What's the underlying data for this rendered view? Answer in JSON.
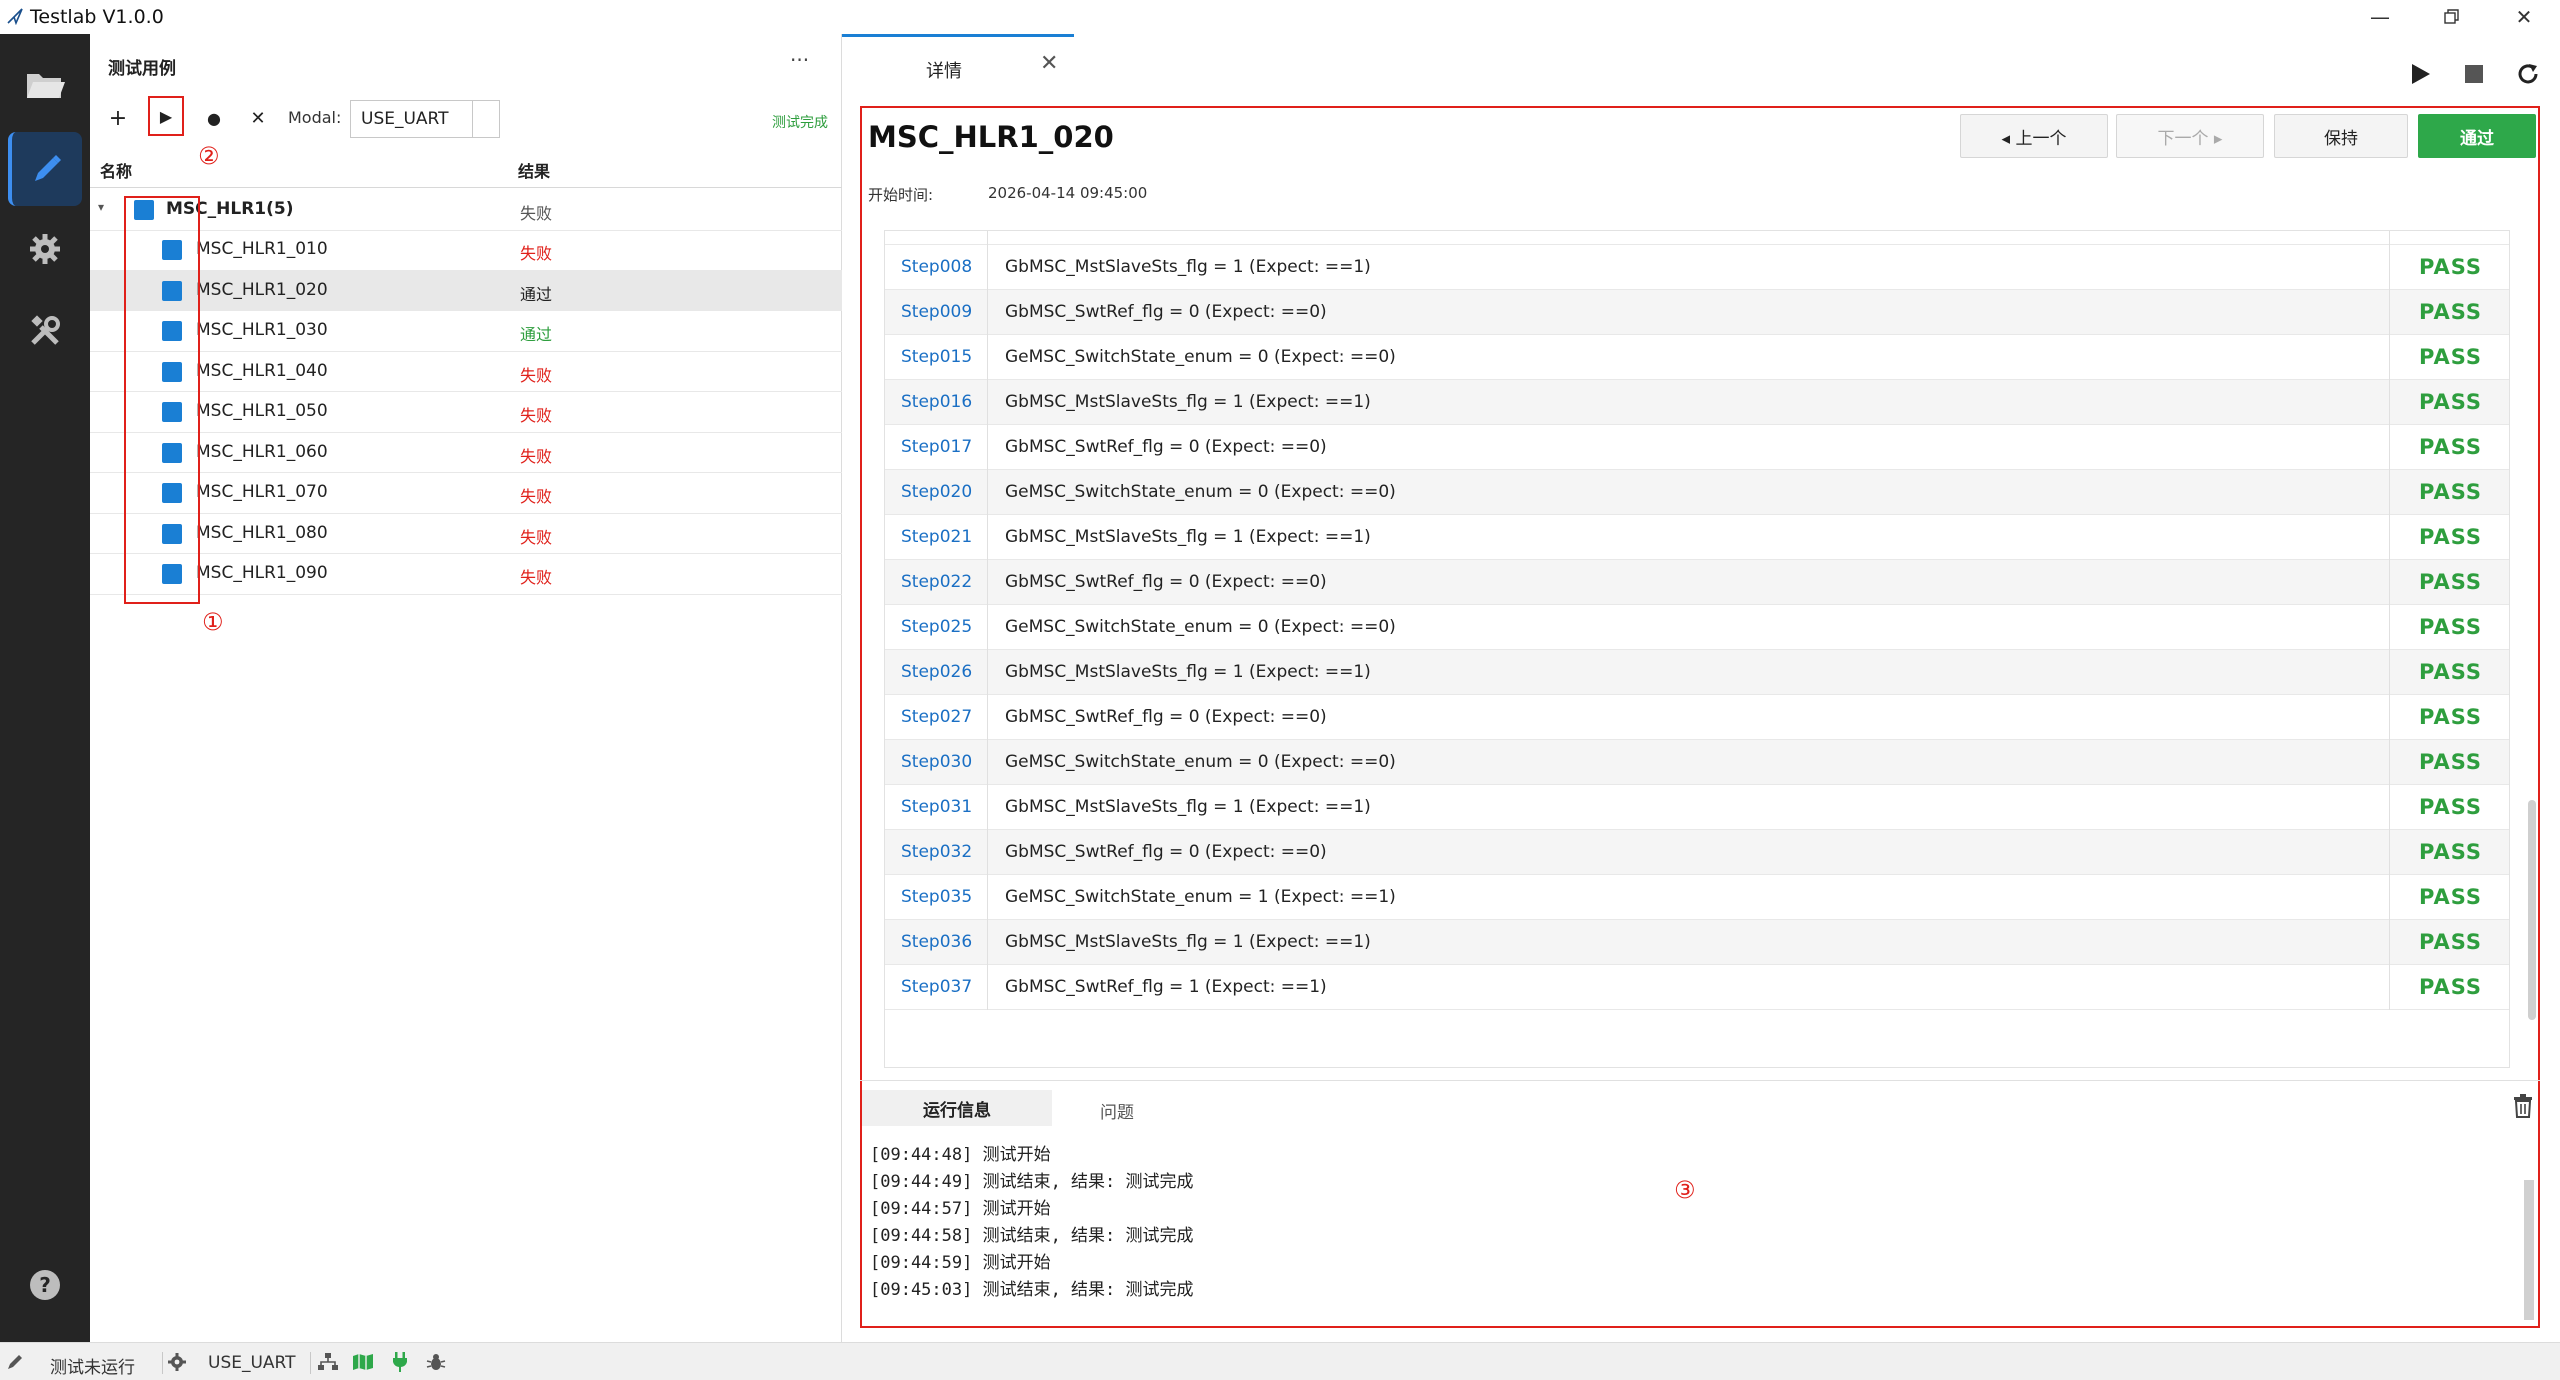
{
  "app": {
    "title": "Testlab V1.0.0"
  },
  "left_panel": {
    "title": "测试用例",
    "more": "···",
    "toolbar": {
      "add": "+",
      "run": "▶",
      "record": "●",
      "delete": "✕",
      "modal_label": "Modal:",
      "modal_value": "USE_UART",
      "status": "测试完成"
    },
    "columns": {
      "name": "名称",
      "result": "结果"
    },
    "group": {
      "name": "MSC_HLR1(5)",
      "result": "失败"
    },
    "cases": [
      {
        "name": "MSC_HLR1_010",
        "result": "失败",
        "status": "fail"
      },
      {
        "name": "MSC_HLR1_020",
        "result": "通过",
        "status": "selected"
      },
      {
        "name": "MSC_HLR1_030",
        "result": "通过",
        "status": "pass"
      },
      {
        "name": "MSC_HLR1_040",
        "result": "失败",
        "status": "fail"
      },
      {
        "name": "MSC_HLR1_050",
        "result": "失败",
        "status": "fail"
      },
      {
        "name": "MSC_HLR1_060",
        "result": "失败",
        "status": "fail"
      },
      {
        "name": "MSC_HLR1_070",
        "result": "失败",
        "status": "fail"
      },
      {
        "name": "MSC_HLR1_080",
        "result": "失败",
        "status": "fail"
      },
      {
        "name": "MSC_HLR1_090",
        "result": "失败",
        "status": "fail"
      }
    ],
    "markers": {
      "m1": "①",
      "m2": "②"
    }
  },
  "detail": {
    "tab_label": "详情",
    "case_title": "MSC_HLR1_020",
    "start_label": "开始时间:",
    "start_value": "2026-04-14 09:45:00",
    "buttons": {
      "prev": "◂ 上一个",
      "next": "下一个 ▸",
      "hold": "保持",
      "pass": "通过"
    },
    "steps": [
      {
        "id": "Step008",
        "desc": "GbMSC_MstSlaveSts_flg = 1 (Expect: ==1)",
        "result": "PASS"
      },
      {
        "id": "Step009",
        "desc": "GbMSC_SwtRef_flg = 0 (Expect: ==0)",
        "result": "PASS"
      },
      {
        "id": "Step015",
        "desc": "GeMSC_SwitchState_enum = 0 (Expect: ==0)",
        "result": "PASS"
      },
      {
        "id": "Step016",
        "desc": "GbMSC_MstSlaveSts_flg = 1 (Expect: ==1)",
        "result": "PASS"
      },
      {
        "id": "Step017",
        "desc": "GbMSC_SwtRef_flg = 0 (Expect: ==0)",
        "result": "PASS"
      },
      {
        "id": "Step020",
        "desc": "GeMSC_SwitchState_enum = 0 (Expect: ==0)",
        "result": "PASS"
      },
      {
        "id": "Step021",
        "desc": "GbMSC_MstSlaveSts_flg = 1 (Expect: ==1)",
        "result": "PASS"
      },
      {
        "id": "Step022",
        "desc": "GbMSC_SwtRef_flg = 0 (Expect: ==0)",
        "result": "PASS"
      },
      {
        "id": "Step025",
        "desc": "GeMSC_SwitchState_enum = 0 (Expect: ==0)",
        "result": "PASS"
      },
      {
        "id": "Step026",
        "desc": "GbMSC_MstSlaveSts_flg = 1 (Expect: ==1)",
        "result": "PASS"
      },
      {
        "id": "Step027",
        "desc": "GbMSC_SwtRef_flg = 0 (Expect: ==0)",
        "result": "PASS"
      },
      {
        "id": "Step030",
        "desc": "GeMSC_SwitchState_enum = 0 (Expect: ==0)",
        "result": "PASS"
      },
      {
        "id": "Step031",
        "desc": "GbMSC_MstSlaveSts_flg = 1 (Expect: ==1)",
        "result": "PASS"
      },
      {
        "id": "Step032",
        "desc": "GbMSC_SwtRef_flg = 0 (Expect: ==0)",
        "result": "PASS"
      },
      {
        "id": "Step035",
        "desc": "GeMSC_SwitchState_enum = 1 (Expect: ==1)",
        "result": "PASS"
      },
      {
        "id": "Step036",
        "desc": "GbMSC_MstSlaveSts_flg = 1 (Expect: ==1)",
        "result": "PASS"
      },
      {
        "id": "Step037",
        "desc": "GbMSC_SwtRef_flg = 1 (Expect: ==1)",
        "result": "PASS"
      }
    ],
    "log_tabs": {
      "run": "运行信息",
      "issues": "问题"
    },
    "log_lines": [
      "[09:44:48] 测试开始",
      "[09:44:49] 测试结束, 结果: 测试完成",
      "[09:44:57] 测试开始",
      "[09:44:58] 测试结束, 结果: 测试完成",
      "[09:44:59] 测试开始",
      "[09:45:03] 测试结束, 结果: 测试完成"
    ],
    "marker3": "③"
  },
  "statusbar": {
    "run_state": "测试未运行",
    "modal": "USE_UART"
  },
  "colors": {
    "accent": "#1a7fd4",
    "pass": "#2e9e3e",
    "fail": "#e0201a",
    "activity_bg": "#252525"
  }
}
